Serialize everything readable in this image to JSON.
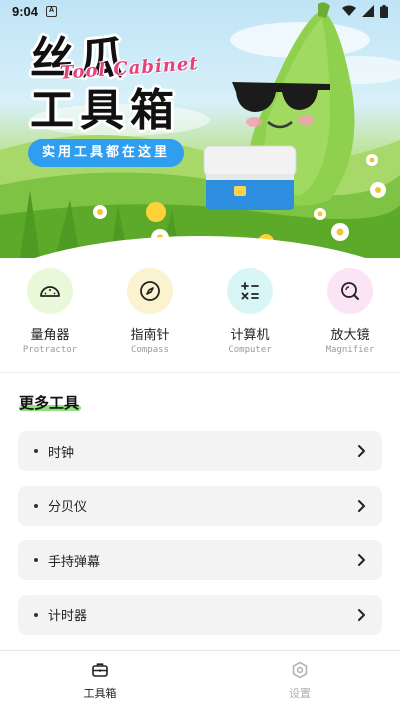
{
  "status_bar": {
    "time": "9:04",
    "notif_letter": "A"
  },
  "hero": {
    "title_line1": "丝瓜",
    "title_line2": "工具箱",
    "script_text": "Tool Cabinet",
    "tagline": "实用工具都在这里"
  },
  "tools": [
    {
      "name": "量角器",
      "en": "Protractor",
      "icon": "protractor-icon",
      "bg": "#e9f8d8"
    },
    {
      "name": "指南针",
      "en": "Compass",
      "icon": "compass-icon",
      "bg": "#fbf3cf"
    },
    {
      "name": "计算机",
      "en": "Computer",
      "icon": "calculator-icon",
      "bg": "#d9f6f6"
    },
    {
      "name": "放大镜",
      "en": "Magnifier",
      "icon": "magnifier-icon",
      "bg": "#fbe4f5"
    }
  ],
  "more_tools": {
    "title": "更多工具",
    "items": [
      "时钟",
      "分贝仪",
      "手持弹幕",
      "计时器"
    ]
  },
  "bottom_nav": [
    {
      "label": "工具箱",
      "icon": "toolbox-icon",
      "active": true
    },
    {
      "label": "设置",
      "icon": "settings-icon",
      "active": false
    }
  ],
  "colors": {
    "accent_blue": "#2f9df0",
    "accent_green": "#8ee27c",
    "title_pink": "#e7407d"
  }
}
